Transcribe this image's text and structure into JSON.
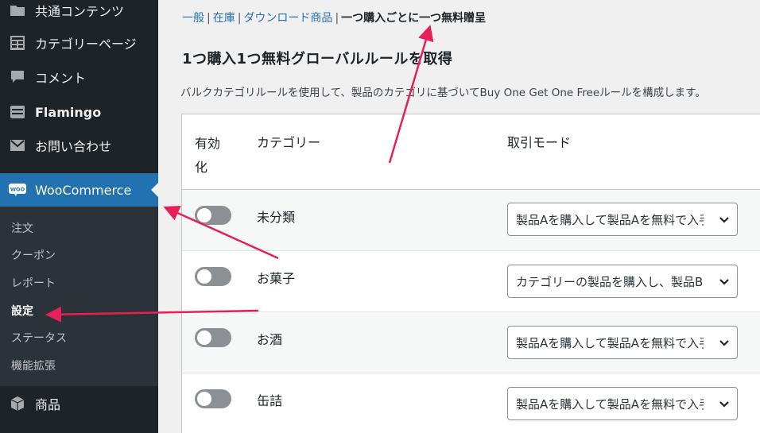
{
  "sidebar": {
    "items": [
      {
        "label": "共通コンテンツ",
        "icon": "folder-icon"
      },
      {
        "label": "カテゴリーページ",
        "icon": "grid-icon"
      },
      {
        "label": "コメント",
        "icon": "comment-icon"
      },
      {
        "label": "Flamingo",
        "icon": "flamingo-icon"
      },
      {
        "label": "お問い合わせ",
        "icon": "mail-icon"
      },
      {
        "label": "WooCommerce",
        "icon": "woo-icon"
      },
      {
        "label": "商品",
        "icon": "product-icon"
      }
    ],
    "woo_icon_text": "WOO",
    "submenu": [
      "注文",
      "クーポン",
      "レポート",
      "設定",
      "ステータス",
      "機能拡張"
    ]
  },
  "tabs": {
    "general": "一般",
    "inventory": "在庫",
    "downloads": "ダウンロード商品",
    "current": "一つ購入ごとに一つ無料贈呈"
  },
  "page": {
    "title": "1つ購入1つ無料グローバルルールを取得",
    "description": "バルクカテゴリルールを使用して、製品のカテゴリに基づいてBuy One Get One Freeルールを構成します。"
  },
  "table": {
    "headers": {
      "enable_line1": "有効",
      "enable_line2": "化",
      "category": "カテゴリー",
      "mode": "取引モード"
    },
    "rows": [
      {
        "category": "未分類",
        "mode": "製品Aを購入して製品Aを無料で入手",
        "enabled": false
      },
      {
        "category": "お菓子",
        "mode": "カテゴリーの製品を購入し、製品Bを無料で入手",
        "enabled": false
      },
      {
        "category": "お酒",
        "mode": "製品Aを購入して製品Aを無料で入手",
        "enabled": false
      },
      {
        "category": "缶詰",
        "mode": "製品Aを購入して製品Aを無料で入手",
        "enabled": false
      }
    ]
  },
  "colors": {
    "accent": "#2271b1",
    "annotation_arrow": "#e8205a",
    "sidebar": "#1d2327"
  }
}
